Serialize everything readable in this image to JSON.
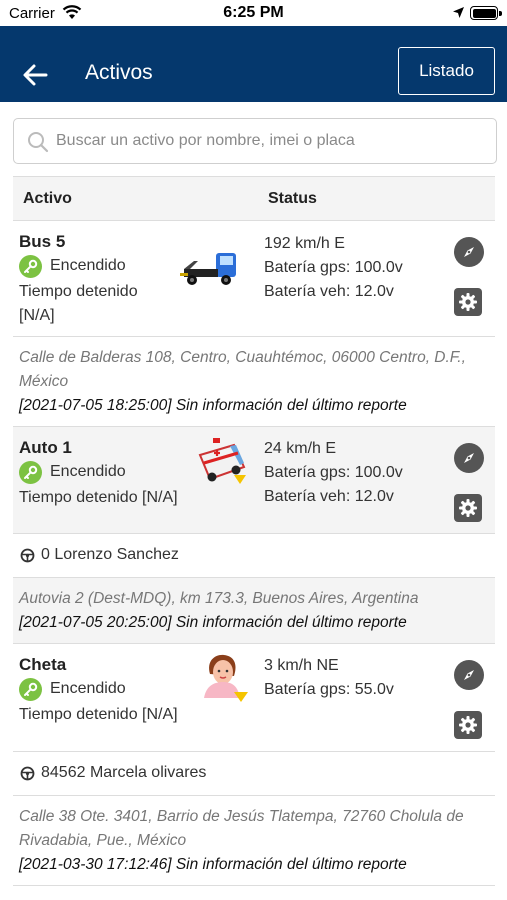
{
  "status_bar": {
    "carrier": "Carrier",
    "time": "6:25 PM"
  },
  "header": {
    "title": "Activos",
    "list_button": "Listado"
  },
  "search": {
    "placeholder": "Buscar un activo por nombre, imei o placa"
  },
  "table": {
    "col_asset": "Activo",
    "col_status": "Status"
  },
  "assets": [
    {
      "name": "Bus 5",
      "ignition": "Encendido",
      "stopped_line1": "Tiempo detenido",
      "stopped_line2": "[N/A]",
      "speed": "192 km/h E",
      "gps_battery": "Batería gps: 100.0v",
      "veh_battery": "Batería veh: 12.0v",
      "address": "Calle de Balderas 108, Centro, Cuauhtémoc, 06000 Centro, D.F., México",
      "report": "[2021-07-05 18:25:00] Sin información del último reporte"
    },
    {
      "name": "Auto 1",
      "ignition": "Encendido",
      "stopped": "Tiempo detenido [N/A]",
      "speed": "24 km/h E",
      "gps_battery": "Batería gps: 100.0v",
      "veh_battery": "Batería veh: 12.0v",
      "driver": "0 Lorenzo Sanchez",
      "address": "Autovia 2 (Dest-MDQ), km 173.3, Buenos Aires, Argentina",
      "report": "[2021-07-05 20:25:00] Sin información del último reporte"
    },
    {
      "name": "Cheta",
      "ignition": "Encendido",
      "stopped": "Tiempo detenido [N/A]",
      "speed": "3 km/h NE",
      "gps_battery": "Batería gps: 55.0v",
      "driver": "84562 Marcela olivares",
      "address": "Calle 38 Ote. 3401, Barrio de Jesús Tlatempa, 72760 Cholula de Rivadabia, Pue., México",
      "report": "[2021-03-30 17:12:46] Sin información del último reporte"
    }
  ],
  "colors": {
    "navbar": "#05386d",
    "ignition_on": "#7cc242",
    "action_buttons": "#555555"
  },
  "icons": [
    "wifi-icon",
    "location-arrow-icon",
    "battery-icon",
    "back-arrow-icon",
    "search-icon",
    "key-icon",
    "tow-truck-icon",
    "ambulance-icon",
    "person-icon",
    "compass-icon",
    "gear-icon",
    "steering-wheel-icon"
  ]
}
